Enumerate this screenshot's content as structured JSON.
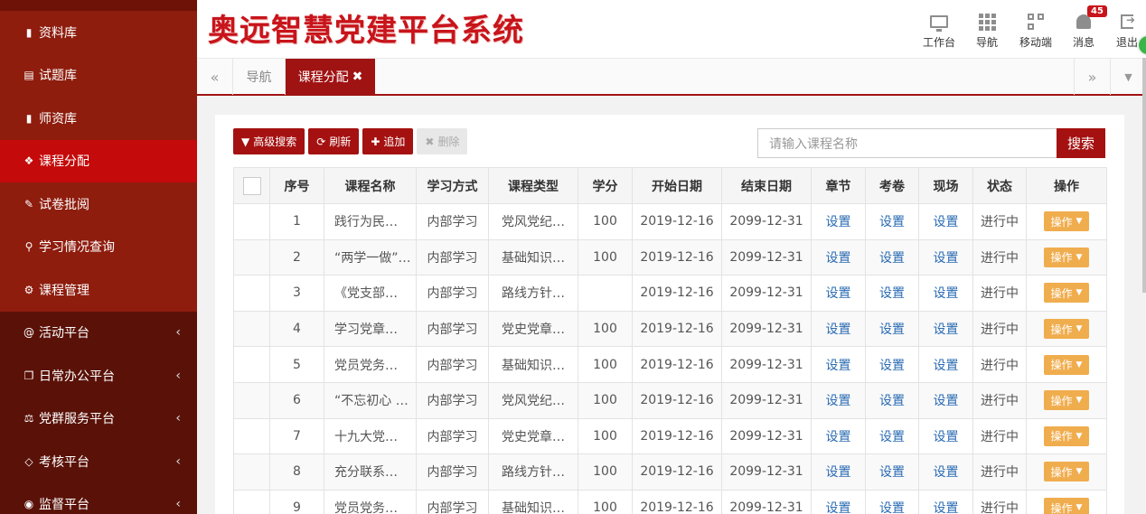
{
  "app": {
    "title": "奥远智慧党建平台系统"
  },
  "sidebar": {
    "items": [
      {
        "label": "资料库",
        "icon": "book-icon",
        "type": "sub"
      },
      {
        "label": "试题库",
        "icon": "newspaper-icon",
        "type": "sub"
      },
      {
        "label": "师资库",
        "icon": "book-bookmark-icon",
        "type": "sub"
      },
      {
        "label": "课程分配",
        "icon": "cubes-icon",
        "type": "active"
      },
      {
        "label": "试卷批阅",
        "icon": "pencil-icon",
        "type": "sub"
      },
      {
        "label": "学习情况查询",
        "icon": "search-icon",
        "type": "sub"
      },
      {
        "label": "课程管理",
        "icon": "cogs-icon",
        "type": "sub"
      },
      {
        "label": "活动平台",
        "icon": "at-icon",
        "type": "group",
        "arrow": "‹"
      },
      {
        "label": "日常办公平台",
        "icon": "copy-icon",
        "type": "group",
        "arrow": "‹"
      },
      {
        "label": "党群服务平台",
        "icon": "balance-scale-icon",
        "type": "group",
        "arrow": "‹"
      },
      {
        "label": "考核平台",
        "icon": "diamond-icon",
        "type": "group",
        "arrow": "‹"
      },
      {
        "label": "监督平台",
        "icon": "eye-icon",
        "type": "group",
        "arrow": "‹"
      }
    ]
  },
  "header": {
    "nav": [
      {
        "label": "工作台",
        "icon": "desktop-icon"
      },
      {
        "label": "导航",
        "icon": "grid-icon"
      },
      {
        "label": "移动端",
        "icon": "qrcode-icon"
      },
      {
        "label": "消息",
        "icon": "bell-icon",
        "badge": "45"
      },
      {
        "label": "退出",
        "icon": "sign-out-icon"
      }
    ]
  },
  "tabs": {
    "prev": "«",
    "next": "»",
    "dropdown": "▼",
    "items": [
      {
        "label": "导航"
      },
      {
        "label": "课程分配",
        "close": "✖"
      }
    ]
  },
  "toolbar": {
    "advanced_search": "高级搜索",
    "refresh": "刷新",
    "add": "追加",
    "delete": "删除"
  },
  "search": {
    "placeholder": "请输入课程名称",
    "button": "搜索"
  },
  "table": {
    "columns": [
      "序号",
      "课程名称",
      "学习方式",
      "课程类型",
      "学分",
      "开始日期",
      "结束日期",
      "章节",
      "考卷",
      "现场",
      "状态",
      "操作"
    ],
    "rows": [
      {
        "no": "1",
        "name": "践行为民…",
        "mode": "内部学习",
        "type": "党风党纪…",
        "credit": "100",
        "start": "2019-12-16",
        "end": "2099-12-31",
        "chapter": "设置",
        "exam": "设置",
        "site": "设置",
        "status": "进行中",
        "op": "操作"
      },
      {
        "no": "2",
        "name": "“两学一做”…",
        "mode": "内部学习",
        "type": "基础知识…",
        "credit": "100",
        "start": "2019-12-16",
        "end": "2099-12-31",
        "chapter": "设置",
        "exam": "设置",
        "site": "设置",
        "status": "进行中",
        "op": "操作"
      },
      {
        "no": "3",
        "name": "《党支部…",
        "mode": "内部学习",
        "type": "路线方针…",
        "credit": "",
        "start": "2019-12-16",
        "end": "2099-12-31",
        "chapter": "设置",
        "exam": "设置",
        "site": "设置",
        "status": "进行中",
        "op": "操作"
      },
      {
        "no": "4",
        "name": "学习党章…",
        "mode": "内部学习",
        "type": "党史党章…",
        "credit": "100",
        "start": "2019-12-16",
        "end": "2099-12-31",
        "chapter": "设置",
        "exam": "设置",
        "site": "设置",
        "status": "进行中",
        "op": "操作"
      },
      {
        "no": "5",
        "name": "党员党务…",
        "mode": "内部学习",
        "type": "基础知识…",
        "credit": "100",
        "start": "2019-12-16",
        "end": "2099-12-31",
        "chapter": "设置",
        "exam": "设置",
        "site": "设置",
        "status": "进行中",
        "op": "操作"
      },
      {
        "no": "6",
        "name": "“不忘初心 …",
        "mode": "内部学习",
        "type": "党风党纪…",
        "credit": "100",
        "start": "2019-12-16",
        "end": "2099-12-31",
        "chapter": "设置",
        "exam": "设置",
        "site": "设置",
        "status": "进行中",
        "op": "操作"
      },
      {
        "no": "7",
        "name": "十九大党…",
        "mode": "内部学习",
        "type": "党史党章…",
        "credit": "100",
        "start": "2019-12-16",
        "end": "2099-12-31",
        "chapter": "设置",
        "exam": "设置",
        "site": "设置",
        "status": "进行中",
        "op": "操作"
      },
      {
        "no": "8",
        "name": "充分联系…",
        "mode": "内部学习",
        "type": "路线方针…",
        "credit": "100",
        "start": "2019-12-16",
        "end": "2099-12-31",
        "chapter": "设置",
        "exam": "设置",
        "site": "设置",
        "status": "进行中",
        "op": "操作"
      },
      {
        "no": "9",
        "name": "党员党务…",
        "mode": "内部学习",
        "type": "基础知识…",
        "credit": "100",
        "start": "2019-12-16",
        "end": "2099-12-31",
        "chapter": "设置",
        "exam": "设置",
        "site": "设置",
        "status": "进行中",
        "op": "操作"
      }
    ]
  },
  "colors": {
    "sidebar_bg": "#8b1a0c",
    "sidebar_active": "#c40a0a",
    "brand_red": "#a51111",
    "title_red": "#c8141b",
    "link_blue": "#2a6bb3",
    "op_orange": "#f0ad4e"
  }
}
